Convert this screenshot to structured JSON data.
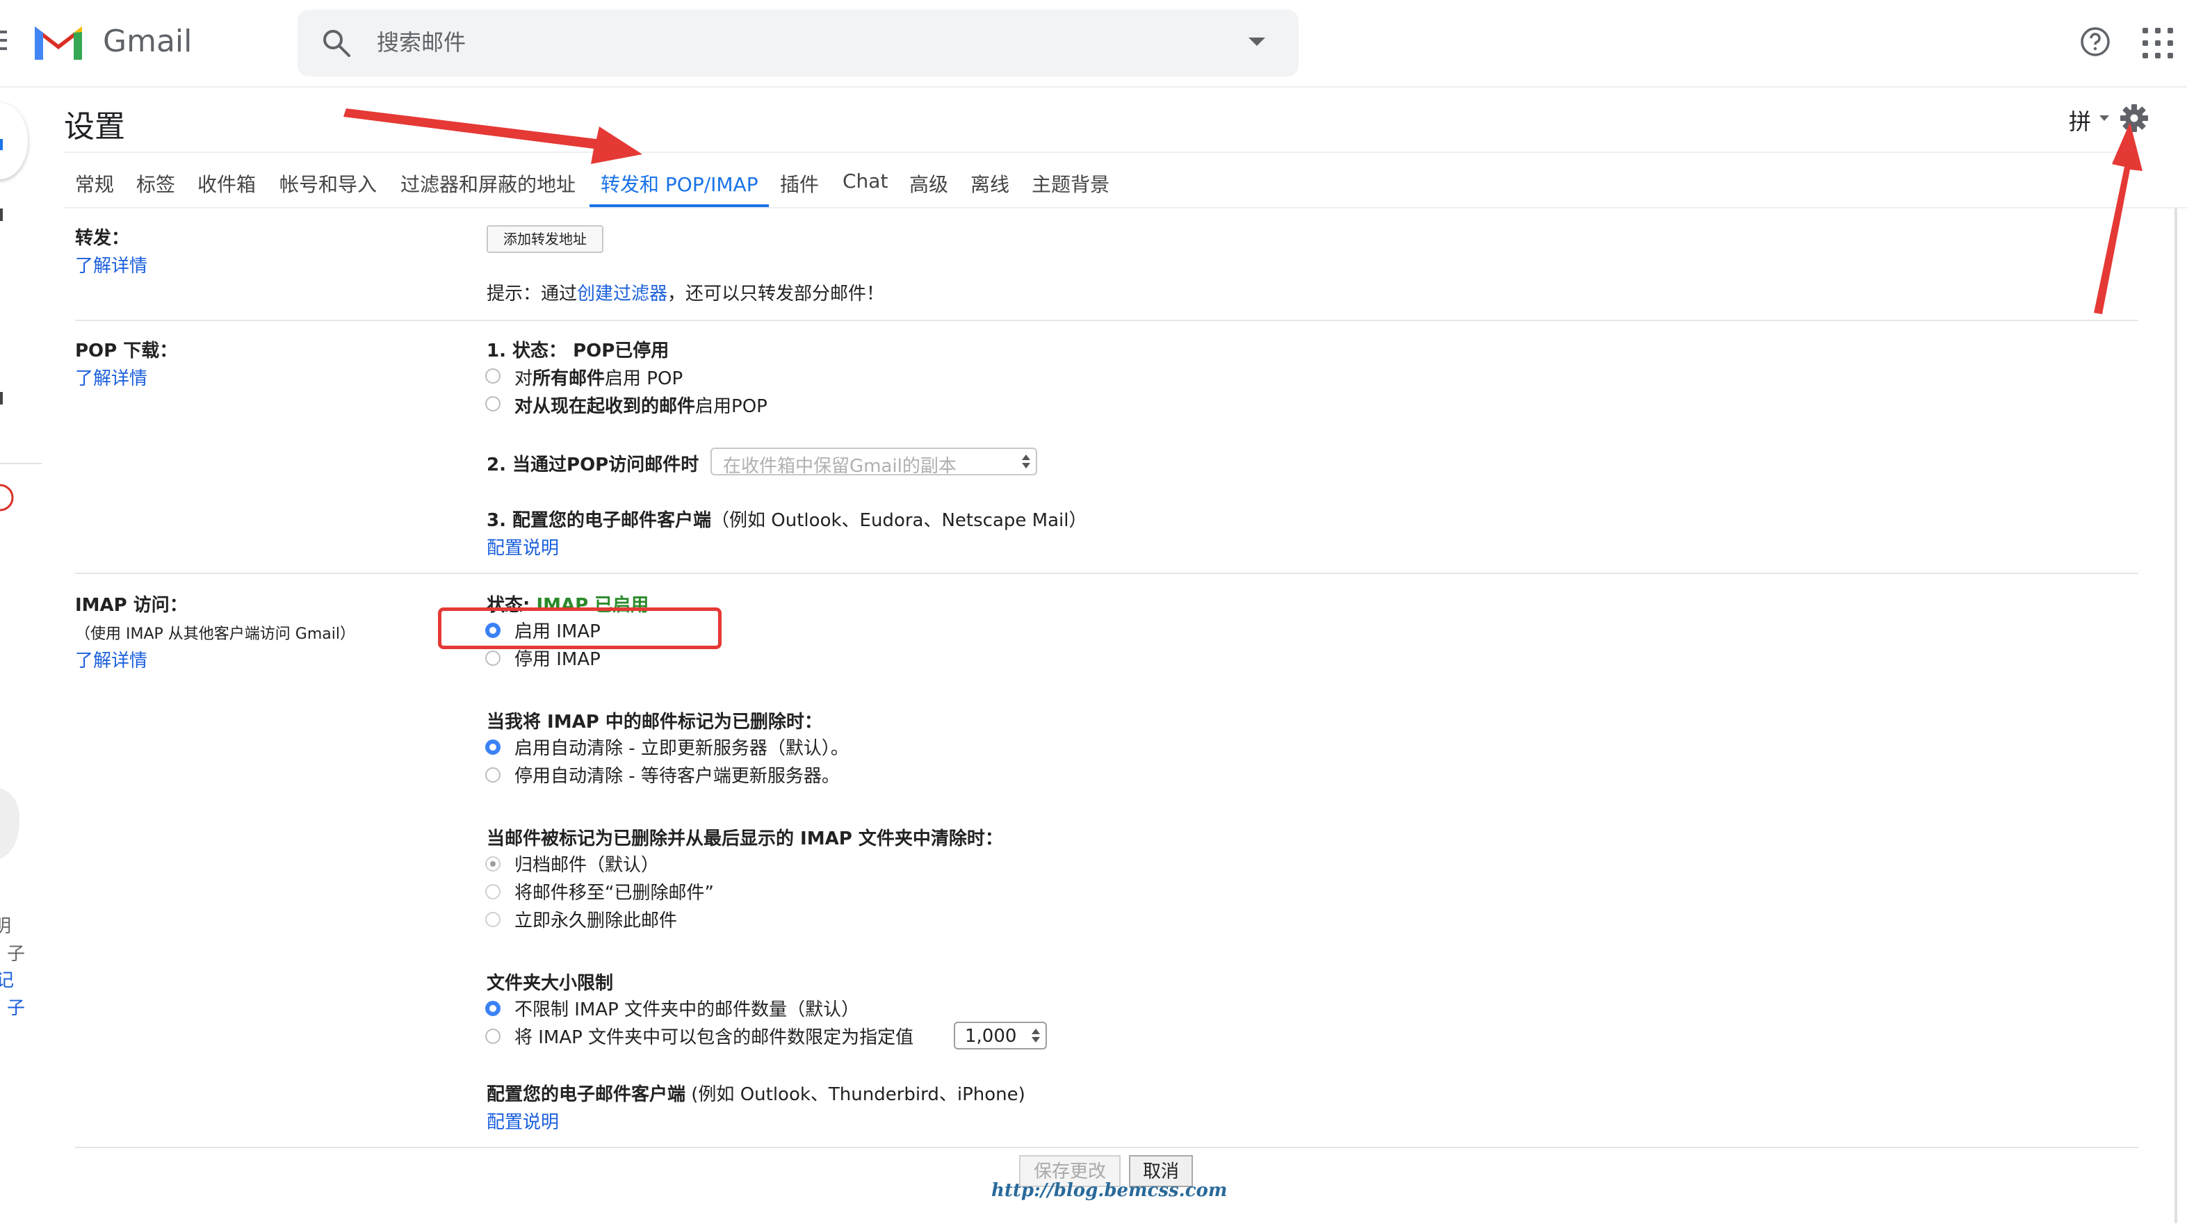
{
  "app": {
    "brand": "Gmail"
  },
  "search": {
    "placeholder": "搜索邮件"
  },
  "settings": {
    "title": "设置",
    "ime": "拼"
  },
  "tabs": [
    {
      "label": "常规"
    },
    {
      "label": "标签"
    },
    {
      "label": "收件箱"
    },
    {
      "label": "帐号和导入"
    },
    {
      "label": "过滤器和屏蔽的地址"
    },
    {
      "label": "转发和 POP/IMAP"
    },
    {
      "label": "插件"
    },
    {
      "label": "Chat"
    },
    {
      "label": "高级"
    },
    {
      "label": "离线"
    },
    {
      "label": "主题背景"
    }
  ],
  "forwarding": {
    "label": "转发：",
    "learn_more": "了解详情",
    "add_button": "添加转发地址",
    "tip_prefix": "提示：通过",
    "tip_link": "创建过滤器",
    "tip_suffix": "，还可以只转发部分邮件！"
  },
  "pop": {
    "label": "POP 下载：",
    "learn_more": "了解详情",
    "status_label": "1. 状态： ",
    "status_value": "POP已停用",
    "opt_all_pre": "对",
    "opt_all_bold": "所有邮件",
    "opt_all_post": "启用 POP",
    "opt_now_bold": "对从现在起收到的邮件",
    "opt_now_post": "启用POP",
    "access_label": "2. 当通过POP访问邮件时",
    "access_select": "在收件箱中保留Gmail的副本",
    "configure_label": "3. 配置您的电子邮件客户端",
    "configure_examples": "（例如 Outlook、Eudora、Netscape Mail）",
    "configure_link": "配置说明"
  },
  "imap": {
    "label": "IMAP 访问：",
    "sublabel": "（使用 IMAP 从其他客户端访问 Gmail）",
    "learn_more": "了解详情",
    "status_label": "状态: ",
    "status_value": "IMAP 已启用",
    "enable": "启用 IMAP",
    "disable": "停用 IMAP",
    "deleted_heading": "当我将 IMAP 中的邮件标记为已删除时：",
    "expunge_on": "启用自动清除 - 立即更新服务器（默认）。",
    "expunge_off": "停用自动清除 - 等待客户端更新服务器。",
    "expunged_heading": "当邮件被标记为已删除并从最后显示的 IMAP 文件夹中清除时：",
    "archive": "归档邮件（默认）",
    "move_trash": "将邮件移至“已删除邮件”",
    "delete_forever": "立即永久删除此邮件",
    "folder_heading": "文件夹大小限制",
    "no_limit": "不限制 IMAP 文件夹中的邮件数量（默认）",
    "limit": "将 IMAP 文件夹中可以包含的邮件数限定为指定值",
    "limit_value": "1,000",
    "client_label": "配置您的电子邮件客户端",
    "client_examples": " (例如 Outlook、Thunderbird、iPhone)",
    "client_link": "配置说明"
  },
  "footer": {
    "save": "保存更改",
    "cancel": "取消",
    "watermark": "http://blog.bemcss.com"
  },
  "left_fragments": {
    "a": "明",
    "b": "子",
    "c": "记",
    "d": "子"
  },
  "colors": {
    "accent": "#1a73e8",
    "link": "#1a5fdc",
    "status_green": "#2a8a2a",
    "annotation_red": "#e53935"
  }
}
